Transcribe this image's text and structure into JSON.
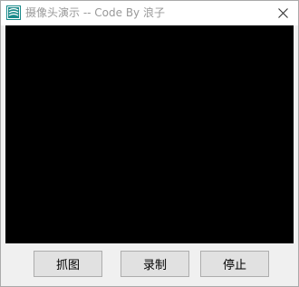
{
  "window": {
    "title": "摄像头演示 -- Code By 浪子",
    "icon": "app-logo-icon",
    "close_icon": "close-icon"
  },
  "preview": {
    "background": "#000000"
  },
  "buttons": {
    "capture_label": "抓图",
    "record_label": "录制",
    "stop_label": "停止"
  },
  "colors": {
    "icon_accent": "#1a8a8a",
    "title_text": "#999999"
  }
}
